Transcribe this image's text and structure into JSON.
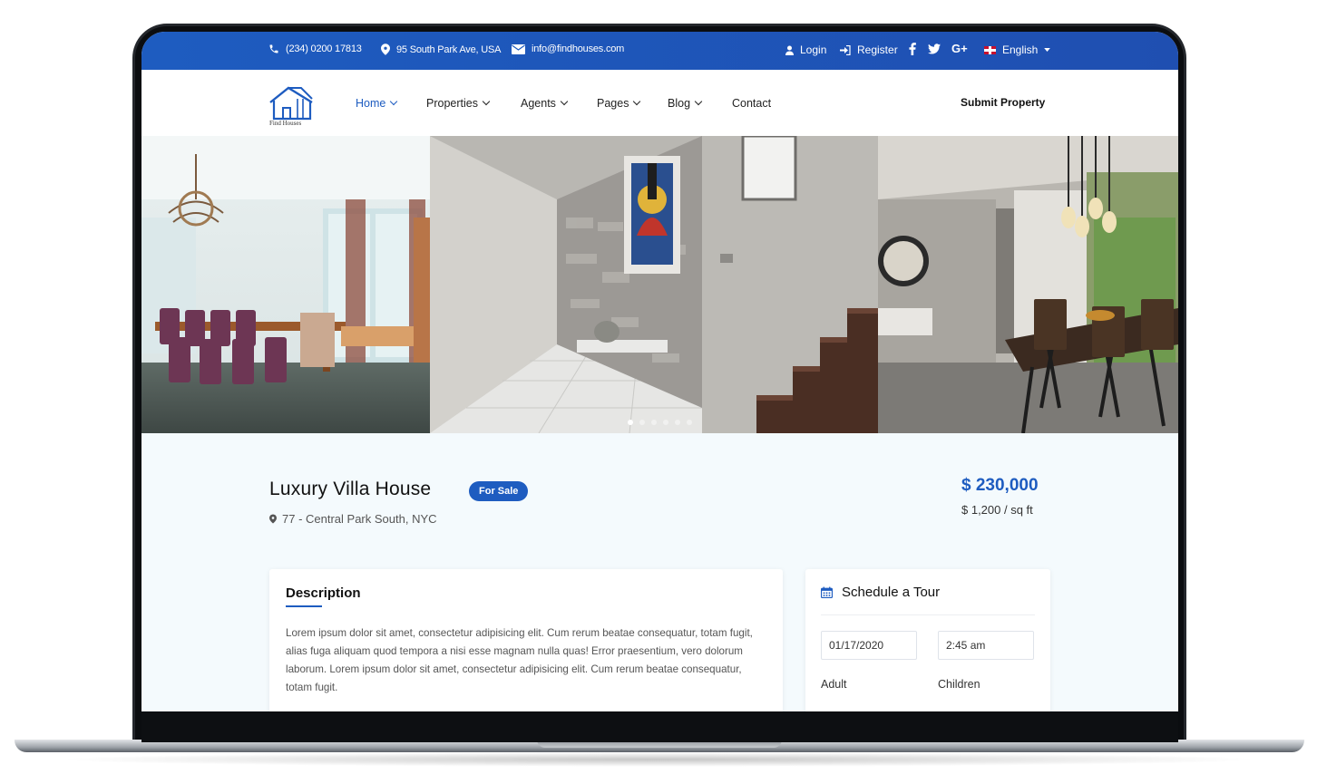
{
  "topbar": {
    "phone": "(234) 0200 17813",
    "address": "95 South Park Ave, USA",
    "email": "info@findhouses.com",
    "login": "Login",
    "register": "Register",
    "language": "English"
  },
  "nav": {
    "logo_text": "Find Houses",
    "items": [
      {
        "label": "Home",
        "dropdown": true,
        "active": true
      },
      {
        "label": "Properties",
        "dropdown": true
      },
      {
        "label": "Agents",
        "dropdown": true
      },
      {
        "label": "Pages",
        "dropdown": true
      },
      {
        "label": "Blog",
        "dropdown": true
      },
      {
        "label": "Contact",
        "dropdown": false
      }
    ],
    "submit_property": "Submit Property"
  },
  "gallery": {
    "slides": [
      "dining-room-photo",
      "hallway-staircase-photo",
      "kitchen-dining-photo"
    ],
    "dots_total": 6,
    "dots_active_index": 0
  },
  "property": {
    "title": "Luxury Villa House",
    "status_badge": "For Sale",
    "address": "77 - Central Park South, NYC",
    "price": "$ 230,000",
    "price_per_sqft": "$ 1,200 / sq ft"
  },
  "description": {
    "heading": "Description",
    "text": "Lorem ipsum dolor sit amet, consectetur adipisicing elit. Cum rerum beatae consequatur, totam fugit, alias fuga aliquam quod tempora a nisi esse magnam nulla quas! Error praesentium, vero dolorum laborum. Lorem ipsum dolor sit amet, consectetur adipisicing elit. Cum rerum beatae consequatur, totam fugit."
  },
  "tour": {
    "heading": "Schedule a Tour",
    "date_value": "01/17/2020",
    "time_value": "2:45 am",
    "adult_label": "Adult",
    "children_label": "Children"
  },
  "colors": {
    "accent": "#1e5cc0",
    "page_bg": "#f4fafd"
  }
}
